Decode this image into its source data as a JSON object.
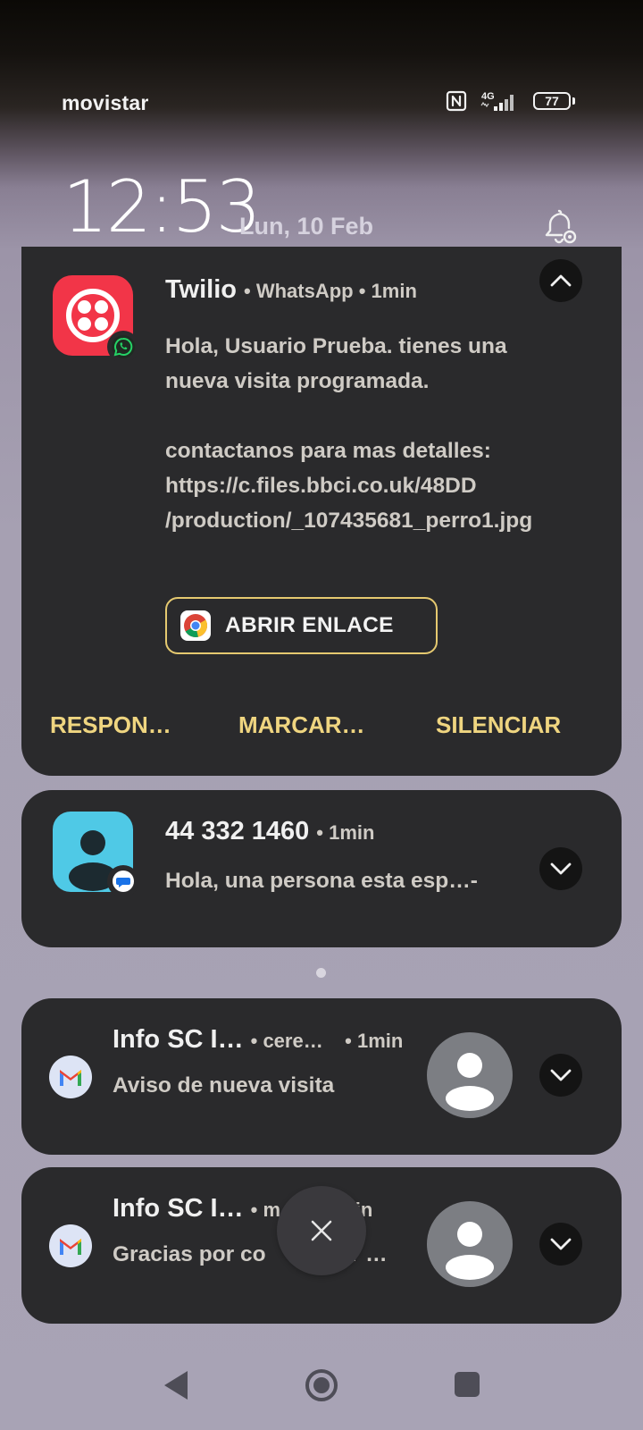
{
  "status_bar": {
    "carrier": "movistar",
    "network": "4G",
    "battery": "77",
    "icons": [
      "nfc-icon",
      "signal-icon",
      "battery-icon"
    ]
  },
  "lockscreen": {
    "time": "12:53",
    "date": "Lun, 10 Feb"
  },
  "notifications": [
    {
      "title": "Twilio",
      "app": "WhatsApp",
      "time": "1min",
      "body": "Hola, Usuario Prueba. tienes una\nnueva visita programada.\n\ncontactanos para mas detalles:\nhttps://c.files.bbci.co.uk/48DD\n/production/_107435681_perro1.jpg",
      "link_button": "ABRIR ENLACE",
      "actions": [
        "RESPON…",
        "MARCAR…",
        "SILENCIAR"
      ]
    },
    {
      "title": "44 332 1460",
      "time": "1min",
      "body": "Hola, una persona esta esp…-"
    },
    {
      "title": "Info SC I…",
      "account": "cere…",
      "time": "1min",
      "body": "Aviso de nueva visita"
    },
    {
      "title": "Info SC I…",
      "account": "m",
      "time": "1min",
      "body": "Gracias por co",
      "body_tail": "pletar …"
    }
  ],
  "colors": {
    "card": "#2a2a2c",
    "accent": "#efd580",
    "twilio": "#f23548",
    "contact": "#4fc9e6"
  }
}
